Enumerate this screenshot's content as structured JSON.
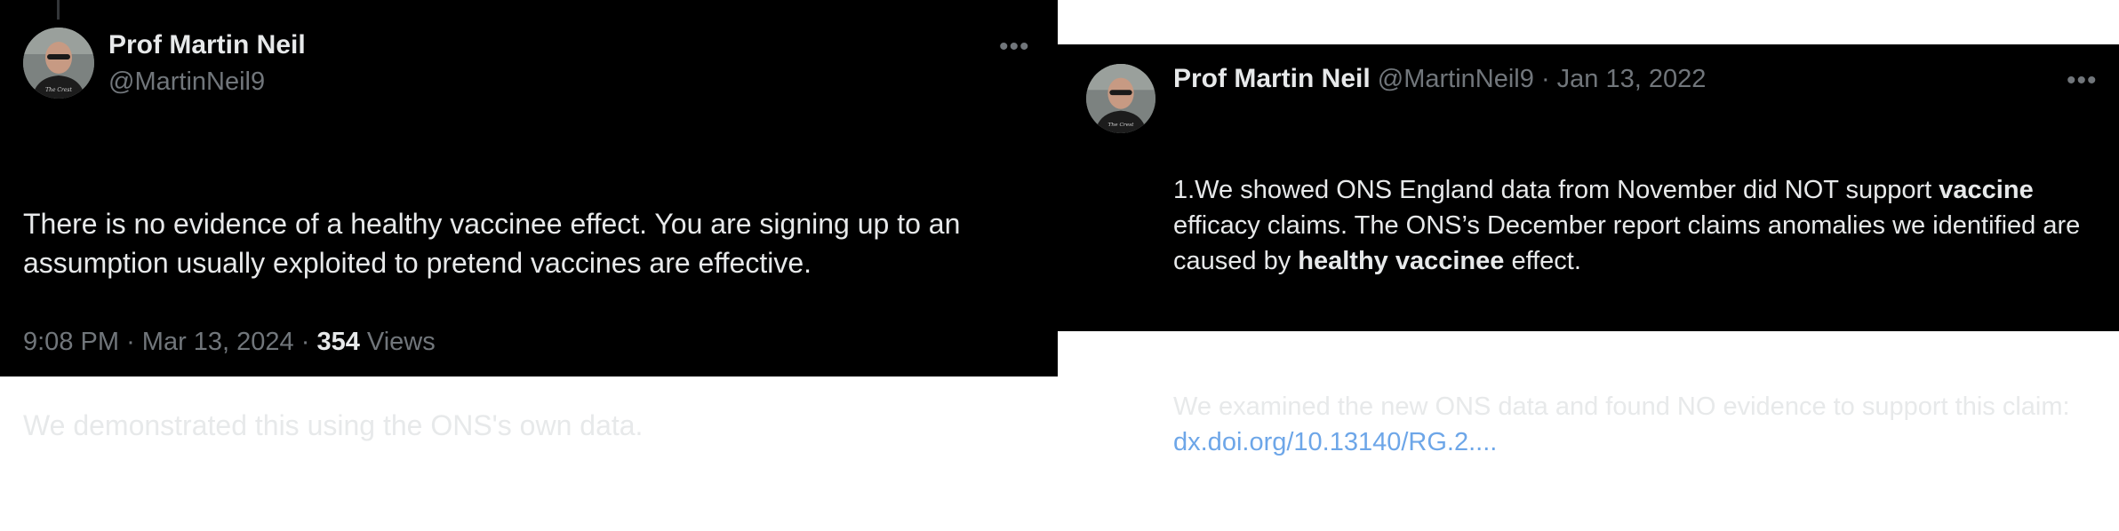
{
  "left_tweet": {
    "author_name": "Prof Martin Neil",
    "author_handle": "@MartinNeil9",
    "more_icon": "more-horizontal-icon",
    "paragraph_1": "There is no evidence of a healthy vaccinee effect. You are signing up to an assumption usually exploited to pretend vaccines are effective.",
    "paragraph_2": "We demonstrated this using the ONS's own data.",
    "time": "9:08 PM",
    "date": "Mar 13, 2024",
    "views_count": "354",
    "views_label": "Views"
  },
  "right_tweet": {
    "author_name": "Prof Martin Neil",
    "author_handle": "@MartinNeil9",
    "separator": "·",
    "date": "Jan 13, 2022",
    "more_icon": "more-horizontal-icon",
    "p1_part1": "1.We showed ONS England data from November did NOT support ",
    "p1_bold1": "vaccine",
    "p1_part2": " efficacy claims. The ONS’s December report claims anomalies we identified are caused by ",
    "p1_bold2": "healthy vaccinee",
    "p1_part3": " effect.",
    "p2_text": "We examined the new ONS data and found NO evidence to support this claim: ",
    "p2_link": "dx.doi.org/10.13140/RG.2...."
  },
  "colors": {
    "background": "#000000",
    "text_primary": "#e7e9ea",
    "text_secondary": "#71767b",
    "link": "#6da6e8"
  }
}
